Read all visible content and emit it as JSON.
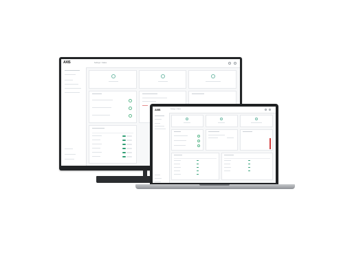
{
  "monitor": {
    "app": {
      "logo": "AXIS",
      "breadcrumb": "Settings  >  Status",
      "sidebar_items": [],
      "bottom_items": []
    }
  },
  "laptop": {
    "app": {
      "logo": "AXIS",
      "breadcrumb": "Settings  >  Status"
    }
  },
  "colors": {
    "accent": "#2f9e74",
    "alert": "#d23b3b",
    "device_frame": "#222426"
  }
}
